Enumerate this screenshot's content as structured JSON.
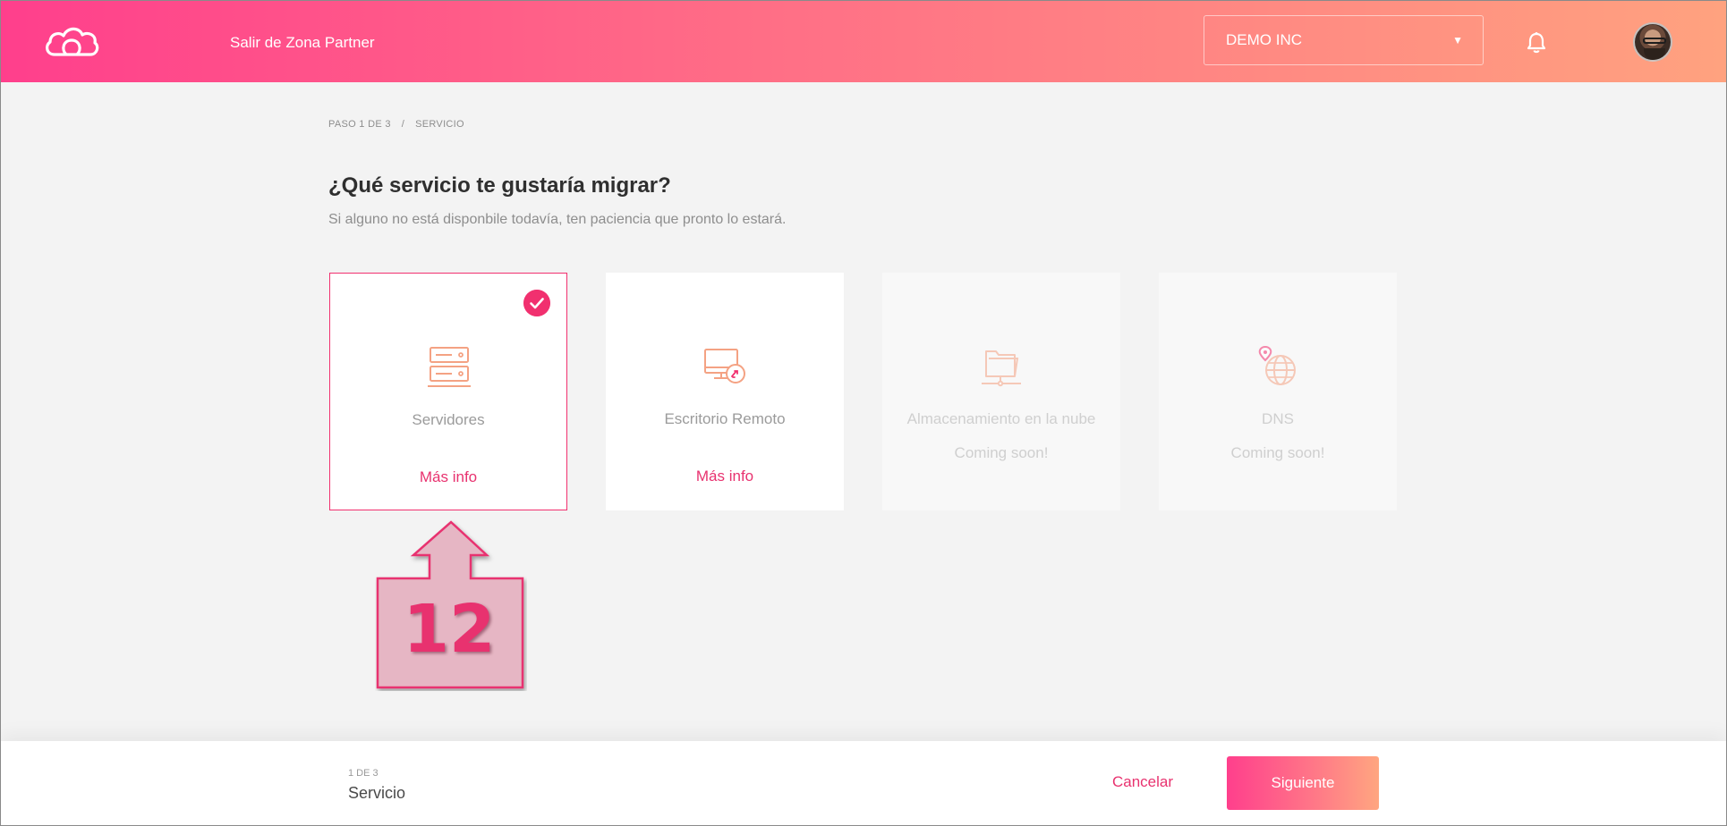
{
  "header": {
    "exit_link": "Salir de Zona Partner",
    "company": "DEMO INC",
    "logo_icon": "cloud-logo-icon",
    "notifications_icon": "bell-icon",
    "avatar_icon": "user-avatar"
  },
  "breadcrumb": {
    "step": "PASO 1 DE 3",
    "separator": "/",
    "current": "SERVICIO"
  },
  "main": {
    "title": "¿Qué servicio te gustaría migrar?",
    "subtitle": "Si alguno no está disponbile todavía, ten paciencia que pronto lo estará.",
    "cards": [
      {
        "name": "Servidores",
        "link": "Más info",
        "state": "selected",
        "icon": "servers-icon"
      },
      {
        "name": "Escritorio Remoto",
        "link": "Más info",
        "state": "available",
        "icon": "remote-desktop-icon"
      },
      {
        "name": "Almacenamiento en la nube",
        "soon": "Coming soon!",
        "state": "disabled",
        "icon": "cloud-storage-folder-icon"
      },
      {
        "name": "DNS",
        "soon": "Coming soon!",
        "state": "disabled",
        "icon": "dns-globe-icon"
      }
    ]
  },
  "annotation": {
    "number": "12",
    "icon": "up-arrow-callout"
  },
  "footer": {
    "step_count": "1 DE 3",
    "step_name": "Servicio",
    "cancel_label": "Cancelar",
    "next_label": "Siguiente"
  },
  "colors": {
    "accent": "#f1306f",
    "gradient_start": "#ff3f8c",
    "gradient_end": "#ffa27f",
    "icon_orange": "#f4a283"
  }
}
